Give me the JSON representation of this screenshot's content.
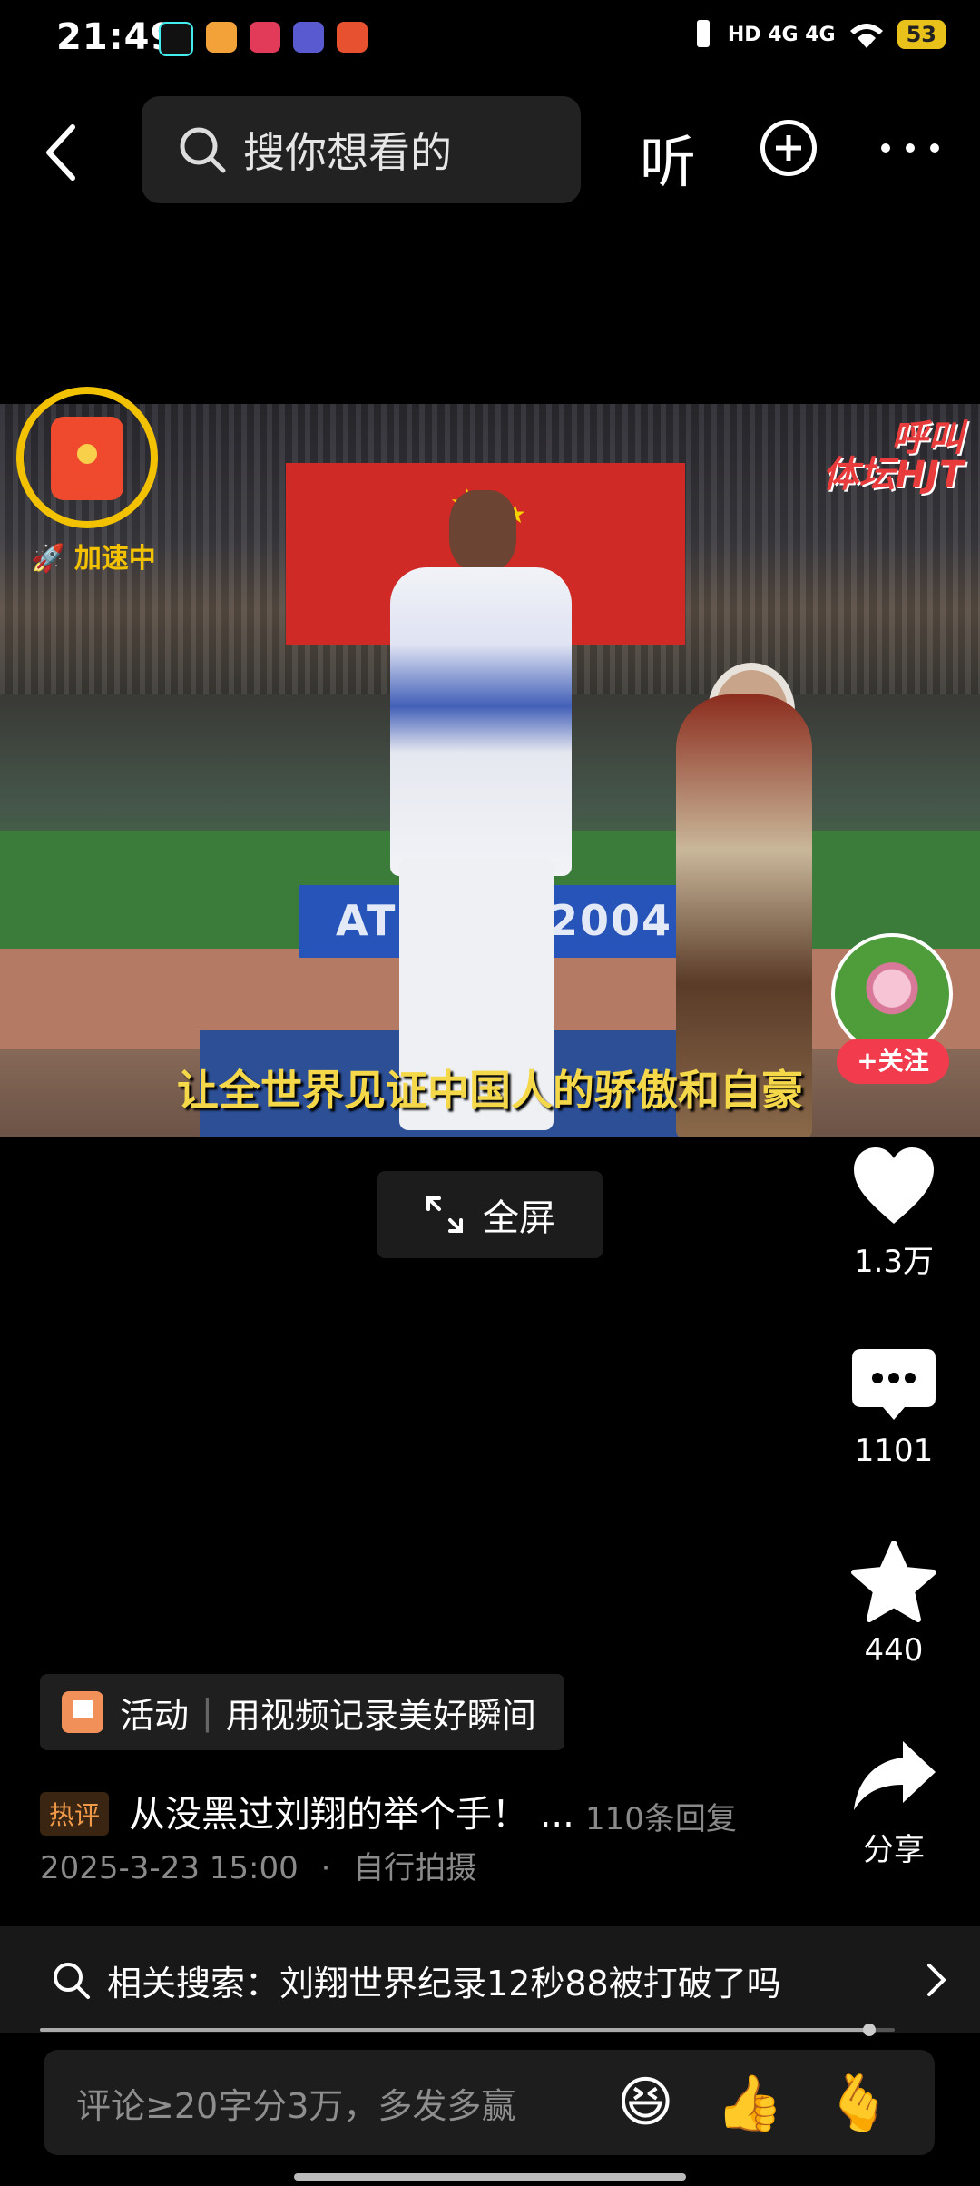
{
  "status": {
    "time": "21:49",
    "network": "HD 4G 4G",
    "battery": "53"
  },
  "topbar": {
    "search_placeholder": "搜你想看的",
    "listen_label": "听"
  },
  "video": {
    "watermark_line1": "呼叫",
    "watermark_line2": "体坛HJT",
    "board_text": "ATHENS 2004",
    "subtitle": "让全世界见证中国人的骄傲和自豪"
  },
  "redpacket": {
    "label": "加速中"
  },
  "follow": {
    "label": "+关注"
  },
  "fullscreen": {
    "label": "全屏"
  },
  "actions": {
    "likes": "1.3万",
    "comments": "1101",
    "favorites": "440",
    "share": "分享"
  },
  "activity": {
    "tag": "活动",
    "text": "用视频记录美好瞬间"
  },
  "hot_comment": {
    "badge": "热评",
    "text": "从没黑过刘翔的举个手！ ...",
    "replies": "110条回复"
  },
  "meta": {
    "date": "2025-3-23 15:00",
    "source": "自行拍摄"
  },
  "related": {
    "prefix": "相关搜索：",
    "query": "刘翔世界纪录12秒88被打破了吗"
  },
  "comment": {
    "placeholder": "评论≥20字分3万，多发多赢"
  },
  "playback_progress": 0.97,
  "colors": {
    "accent_red": "#f23b4c",
    "gold": "#f2c200",
    "subtitle_yellow": "#f5d84a"
  }
}
